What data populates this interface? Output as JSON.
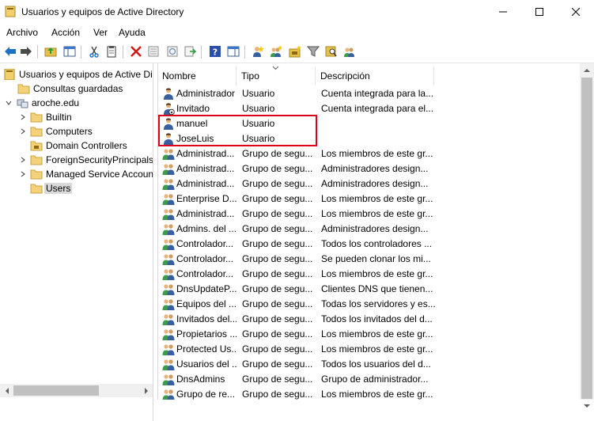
{
  "window": {
    "title": "Usuarios y equipos de Active Directory",
    "minimize_icon": "minimize-icon",
    "maximize_icon": "maximize-icon",
    "close_icon": "close-icon"
  },
  "menu": {
    "items": [
      "Archivo",
      "Acción",
      "Ver",
      "Ayuda"
    ]
  },
  "toolbar": {
    "icons": [
      "back-arrow-icon",
      "forward-arrow-icon",
      "up-folder-icon",
      "show-console-tree-icon",
      "cut-icon",
      "copy-icon",
      "delete-icon",
      "properties-icon",
      "refresh-icon",
      "export-list-icon",
      "help-icon",
      "show-action-pane-icon",
      "new-user-icon",
      "new-group-icon",
      "new-ou-icon",
      "filter-icon",
      "find-icon",
      "add-to-group-icon"
    ]
  },
  "tree": {
    "items": [
      {
        "label": "Usuarios y equipos de Active Direc",
        "icon": "ad-root-icon",
        "level": 0,
        "arrow": ""
      },
      {
        "label": "Consultas guardadas",
        "icon": "folder-icon",
        "level": 1,
        "arrow": ""
      },
      {
        "label": "aroche.edu",
        "icon": "domain-icon",
        "level": 1,
        "arrow": "expanded"
      },
      {
        "label": "Builtin",
        "icon": "folder-icon",
        "level": 2,
        "arrow": "collapsed"
      },
      {
        "label": "Computers",
        "icon": "folder-icon",
        "level": 2,
        "arrow": "collapsed"
      },
      {
        "label": "Domain Controllers",
        "icon": "ou-icon",
        "level": 2,
        "arrow": ""
      },
      {
        "label": "ForeignSecurityPrincipals",
        "icon": "folder-icon",
        "level": 2,
        "arrow": "collapsed"
      },
      {
        "label": "Managed Service Accounts",
        "icon": "folder-icon",
        "level": 2,
        "arrow": "collapsed"
      },
      {
        "label": "Users",
        "icon": "folder-icon",
        "level": 2,
        "arrow": "",
        "selected": true
      }
    ]
  },
  "list": {
    "columns": [
      "Nombre",
      "Tipo",
      "Descripción"
    ],
    "sort_icon": "sort-chevron-icon",
    "rows": [
      {
        "name": "Administrador",
        "type": "Usuario",
        "desc": "Cuenta integrada para la...",
        "icon": "user-icon"
      },
      {
        "name": "Invitado",
        "type": "Usuario",
        "desc": "Cuenta integrada para el...",
        "icon": "disabled-user-icon"
      },
      {
        "name": "manuel",
        "type": "Usuario",
        "desc": "",
        "icon": "user-icon"
      },
      {
        "name": "JoseLuis",
        "type": "Usuario",
        "desc": "",
        "icon": "user-icon"
      },
      {
        "name": "Administrad...",
        "type": "Grupo de segu...",
        "desc": "Los miembros de este gr...",
        "icon": "group-icon"
      },
      {
        "name": "Administrad...",
        "type": "Grupo de segu...",
        "desc": "Administradores design...",
        "icon": "group-icon"
      },
      {
        "name": "Administrad...",
        "type": "Grupo de segu...",
        "desc": "Administradores design...",
        "icon": "group-icon"
      },
      {
        "name": "Enterprise D...",
        "type": "Grupo de segu...",
        "desc": "Los miembros de este gr...",
        "icon": "group-icon"
      },
      {
        "name": "Administrad...",
        "type": "Grupo de segu...",
        "desc": "Los miembros de este gr...",
        "icon": "group-icon"
      },
      {
        "name": "Admins. del ...",
        "type": "Grupo de segu...",
        "desc": "Administradores design...",
        "icon": "group-icon"
      },
      {
        "name": "Controlador...",
        "type": "Grupo de segu...",
        "desc": "Todos los controladores ...",
        "icon": "group-icon"
      },
      {
        "name": "Controlador...",
        "type": "Grupo de segu...",
        "desc": "Se pueden clonar los mi...",
        "icon": "group-icon"
      },
      {
        "name": "Controlador...",
        "type": "Grupo de segu...",
        "desc": "Los miembros de este gr...",
        "icon": "group-icon"
      },
      {
        "name": "DnsUpdateP...",
        "type": "Grupo de segu...",
        "desc": "Clientes DNS que tienen...",
        "icon": "group-icon"
      },
      {
        "name": "Equipos del ...",
        "type": "Grupo de segu...",
        "desc": "Todas los servidores y es...",
        "icon": "group-icon"
      },
      {
        "name": "Invitados del...",
        "type": "Grupo de segu...",
        "desc": "Todos los invitados del d...",
        "icon": "group-icon"
      },
      {
        "name": "Propietarios ...",
        "type": "Grupo de segu...",
        "desc": "Los miembros de este gr...",
        "icon": "group-icon"
      },
      {
        "name": "Protected Us...",
        "type": "Grupo de segu...",
        "desc": "Los miembros de este gr...",
        "icon": "group-icon"
      },
      {
        "name": "Usuarios del ...",
        "type": "Grupo de segu...",
        "desc": "Todos los usuarios del d...",
        "icon": "group-icon"
      },
      {
        "name": "DnsAdmins",
        "type": "Grupo de segu...",
        "desc": "Grupo de administrador...",
        "icon": "group-icon"
      },
      {
        "name": "Grupo de re...",
        "type": "Grupo de segu...",
        "desc": "Los miembros de este gr...",
        "icon": "group-icon"
      }
    ]
  },
  "colors": {
    "highlight_box": "#e0001b",
    "selection": "#d9d9d9"
  }
}
